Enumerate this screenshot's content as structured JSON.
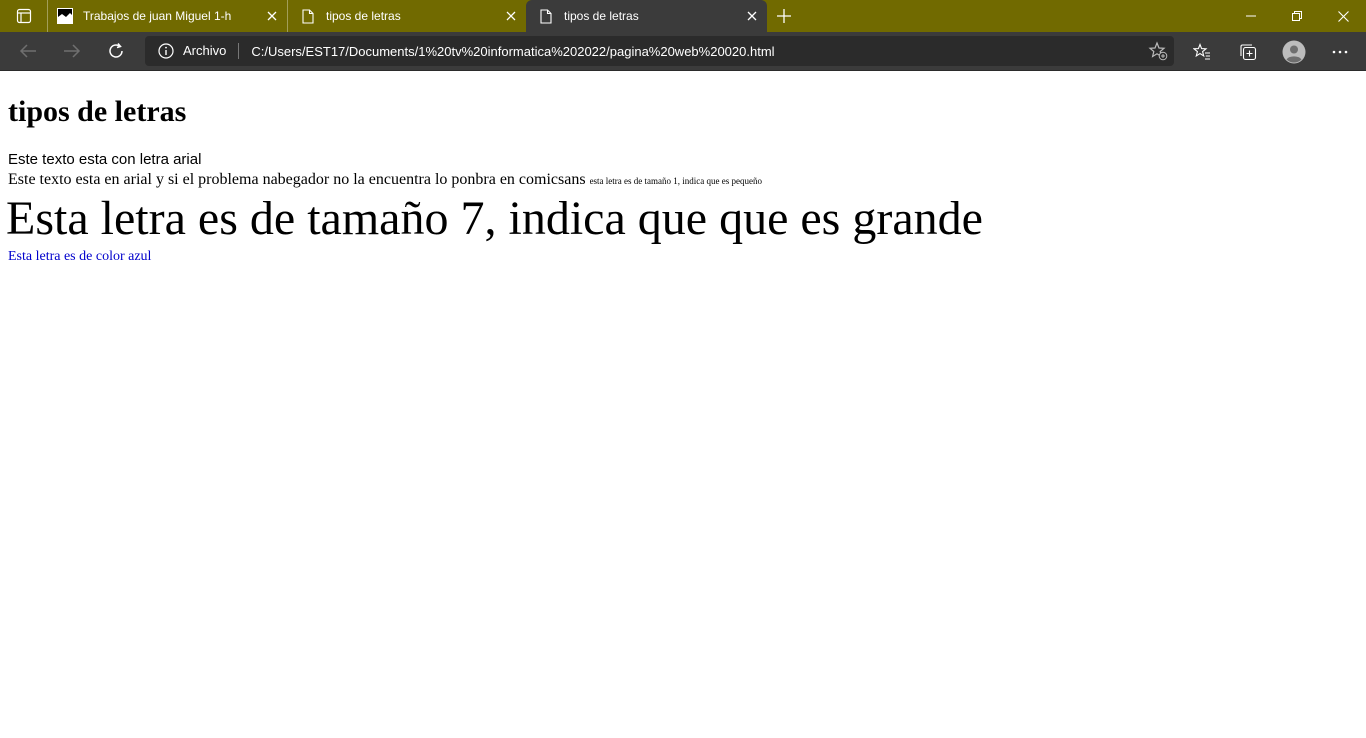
{
  "browser": {
    "tabs": [
      {
        "title": "Trabajos de juan Miguel 1-h",
        "active": false
      },
      {
        "title": "tipos de letras",
        "active": false
      },
      {
        "title": "tipos de letras",
        "active": true
      }
    ],
    "address": {
      "site_label": "Archivo",
      "url": "C:/Users/EST17/Documents/1%20tv%20informatica%202022/pagina%20web%20020.html"
    },
    "colors": {
      "tabstrip_bg": "#716a00",
      "toolbar_bg": "#3b3b3b",
      "address_bg": "#2b2b2b"
    },
    "icons": [
      "tab-actions-icon",
      "page-icon",
      "close-icon",
      "plus-icon",
      "minimize-icon",
      "restore-icon",
      "window-close-icon",
      "back-arrow-icon",
      "forward-arrow-icon",
      "refresh-icon",
      "info-icon",
      "add-favorite-icon",
      "favorites-icon",
      "collections-icon",
      "profile-icon",
      "more-icon"
    ]
  },
  "page": {
    "heading": "tipos de letras",
    "line_arial": "Este texto esta con letra arial",
    "line_comic": "Este texto esta en arial y si el problema nabegador no la encuentra lo ponbra en comicsans",
    "line_small": "esta letra es de tamaño 1, indica que es pequeño",
    "line_big": "Esta letra es de tamaño 7, indica que que es grande",
    "line_blue": "Esta letra es de color azul",
    "blue_color": "#0000cc"
  }
}
